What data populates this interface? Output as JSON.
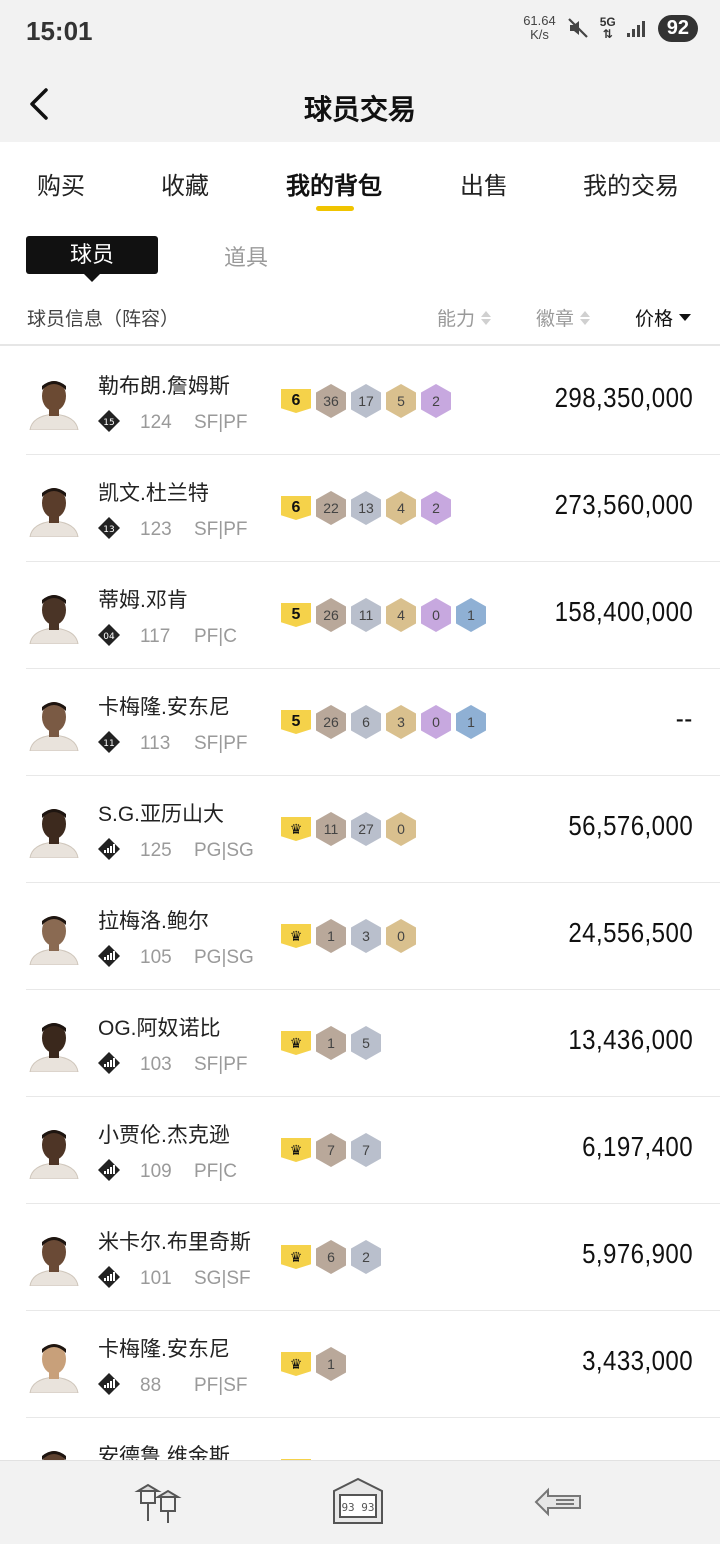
{
  "status_bar": {
    "time": "15:01",
    "speed_value": "61.64",
    "speed_unit": "K/s",
    "network": "5G",
    "battery": "92"
  },
  "header": {
    "title": "球员交易"
  },
  "tabs": [
    {
      "label": "购买"
    },
    {
      "label": "收藏"
    },
    {
      "label": "我的背包"
    },
    {
      "label": "出售"
    },
    {
      "label": "我的交易"
    }
  ],
  "subtabs": {
    "active": "球员",
    "inactive": "道具"
  },
  "columns": {
    "info": "球员信息（阵容）",
    "ability": "能力",
    "badge": "徽章",
    "price": "价格"
  },
  "colors": {
    "accent": "#f0c400",
    "level": "#f5d24a"
  },
  "players": [
    {
      "name": "勒布朗.詹姆斯",
      "rank": "15",
      "ovr": "124",
      "pos": "SF|PF",
      "level": "6",
      "badges": [
        "36",
        "17",
        "5",
        "2"
      ],
      "price": "298,350,000"
    },
    {
      "name": "凯文.杜兰特",
      "rank": "13",
      "ovr": "123",
      "pos": "SF|PF",
      "level": "6",
      "badges": [
        "22",
        "13",
        "4",
        "2"
      ],
      "price": "273,560,000"
    },
    {
      "name": "蒂姆.邓肯",
      "rank": "04",
      "ovr": "117",
      "pos": "PF|C",
      "level": "5",
      "badges": [
        "26",
        "11",
        "4",
        "0",
        "1"
      ],
      "price": "158,400,000"
    },
    {
      "name": "卡梅隆.安东尼",
      "rank": "11",
      "ovr": "113",
      "pos": "SF|PF",
      "level": "5",
      "badges": [
        "26",
        "6",
        "3",
        "0",
        "1"
      ],
      "price": "--"
    },
    {
      "name": "S.G.亚历山大",
      "rank": "",
      "ovr": "125",
      "pos": "PG|SG",
      "level": "crown",
      "badges": [
        "11",
        "27",
        "0"
      ],
      "price": "56,576,000"
    },
    {
      "name": "拉梅洛.鲍尔",
      "rank": "",
      "ovr": "105",
      "pos": "PG|SG",
      "level": "crown",
      "badges": [
        "1",
        "3",
        "0"
      ],
      "price": "24,556,500"
    },
    {
      "name": "OG.阿奴诺比",
      "rank": "",
      "ovr": "103",
      "pos": "SF|PF",
      "level": "crown",
      "badges": [
        "1",
        "5"
      ],
      "price": "13,436,000"
    },
    {
      "name": "小贾伦.杰克逊",
      "rank": "",
      "ovr": "109",
      "pos": "PF|C",
      "level": "crown",
      "badges": [
        "7",
        "7"
      ],
      "price": "6,197,400"
    },
    {
      "name": "米卡尔.布里奇斯",
      "rank": "",
      "ovr": "101",
      "pos": "SG|SF",
      "level": "crown",
      "badges": [
        "6",
        "2"
      ],
      "price": "5,976,900"
    },
    {
      "name": "卡梅隆.安东尼",
      "rank": "",
      "ovr": "88",
      "pos": "PF|SF",
      "level": "crown",
      "badges": [
        "1"
      ],
      "price": "3,433,000"
    },
    {
      "name": "安德鲁.维金斯",
      "rank": "",
      "ovr": "",
      "pos": "",
      "level": "crown",
      "badges": [],
      "price": ""
    }
  ]
}
